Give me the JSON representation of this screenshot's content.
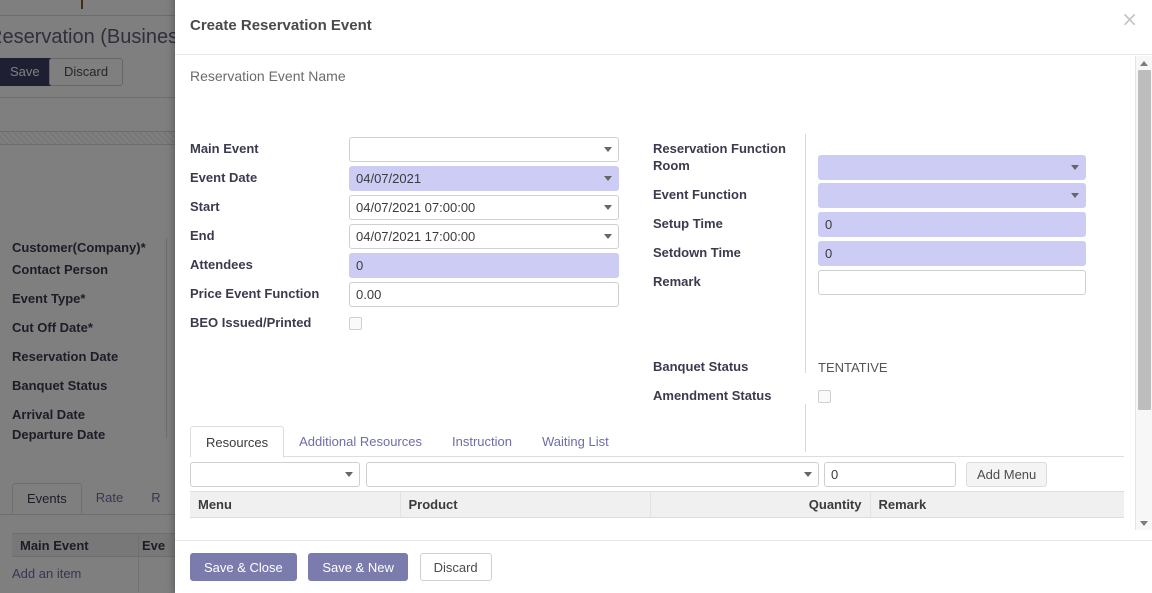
{
  "background": {
    "breadcrumb": "Reservation (Business",
    "save_label": "Save",
    "discard_label": "Discard",
    "field_labels": [
      "Customer(Company)*",
      "Contact Person",
      "Event Type*",
      "Cut Off Date*",
      "Reservation Date",
      "Banquet Status",
      "Arrival Date",
      "Departure Date"
    ],
    "tabs": [
      {
        "label": "Events",
        "active": true
      },
      {
        "label": "Rate",
        "active": false
      },
      {
        "label": "R",
        "active": false
      }
    ],
    "table_headers": [
      "Main Event",
      "Eve"
    ],
    "add_item_label": "Add an item"
  },
  "modal": {
    "title": "Create Reservation Event",
    "close_icon": "close-icon",
    "record_name_placeholder": "Reservation Event Name",
    "record_name_value": "",
    "left_fields": [
      {
        "label": "Main Event",
        "type": "select",
        "value": "",
        "highlight": false
      },
      {
        "label": "Event Date",
        "type": "select",
        "value": "04/07/2021",
        "highlight": true
      },
      {
        "label": "Start",
        "type": "select",
        "value": "04/07/2021 07:00:00",
        "highlight": false
      },
      {
        "label": "End",
        "type": "select",
        "value": "04/07/2021 17:00:00",
        "highlight": false
      },
      {
        "label": "Attendees",
        "type": "text",
        "value": "0",
        "highlight": true
      },
      {
        "label": "Price Event Function",
        "type": "text",
        "value": "0.00",
        "highlight": false
      },
      {
        "label": "BEO Issued/Printed",
        "type": "checkbox",
        "value": "",
        "highlight": false,
        "checked": false
      }
    ],
    "right_fields": [
      {
        "label": "Reservation Function Room",
        "type": "select",
        "value": "",
        "highlight": true,
        "tall": true
      },
      {
        "label": "Event Function",
        "type": "select",
        "value": "",
        "highlight": true,
        "tall": false
      },
      {
        "label": "Setup Time",
        "type": "text",
        "value": "0",
        "highlight": true,
        "tall": false
      },
      {
        "label": "Setdown Time",
        "type": "text",
        "value": "0",
        "highlight": true,
        "tall": false
      },
      {
        "label": "Remark",
        "type": "text",
        "value": "",
        "highlight": false,
        "tall": false
      }
    ],
    "status_fields": [
      {
        "label": "Banquet Status",
        "type": "static",
        "value": "TENTATIVE"
      },
      {
        "label": "Amendment Status",
        "type": "checkbox",
        "value": "",
        "checked": false
      }
    ],
    "notebook": {
      "tabs": [
        {
          "label": "Resources",
          "active": true
        },
        {
          "label": "Additional Resources",
          "active": false
        },
        {
          "label": "Instruction",
          "active": false
        },
        {
          "label": "Waiting List",
          "active": false
        }
      ],
      "toolbar": {
        "menu_select_value": "",
        "product_select_value": "",
        "quantity_value": "0",
        "add_menu_label": "Add Menu"
      },
      "table_headers": [
        "Menu",
        "Product",
        "Quantity",
        "Remark"
      ]
    },
    "footer": {
      "save_close_label": "Save & Close",
      "save_new_label": "Save & New",
      "discard_label": "Discard"
    }
  },
  "colors": {
    "accent_purple": "#7c7bad",
    "field_highlight": "#ccccf5",
    "link_purple": "#6d6da8",
    "overlay": "rgba(0,0,0,0.5)"
  }
}
